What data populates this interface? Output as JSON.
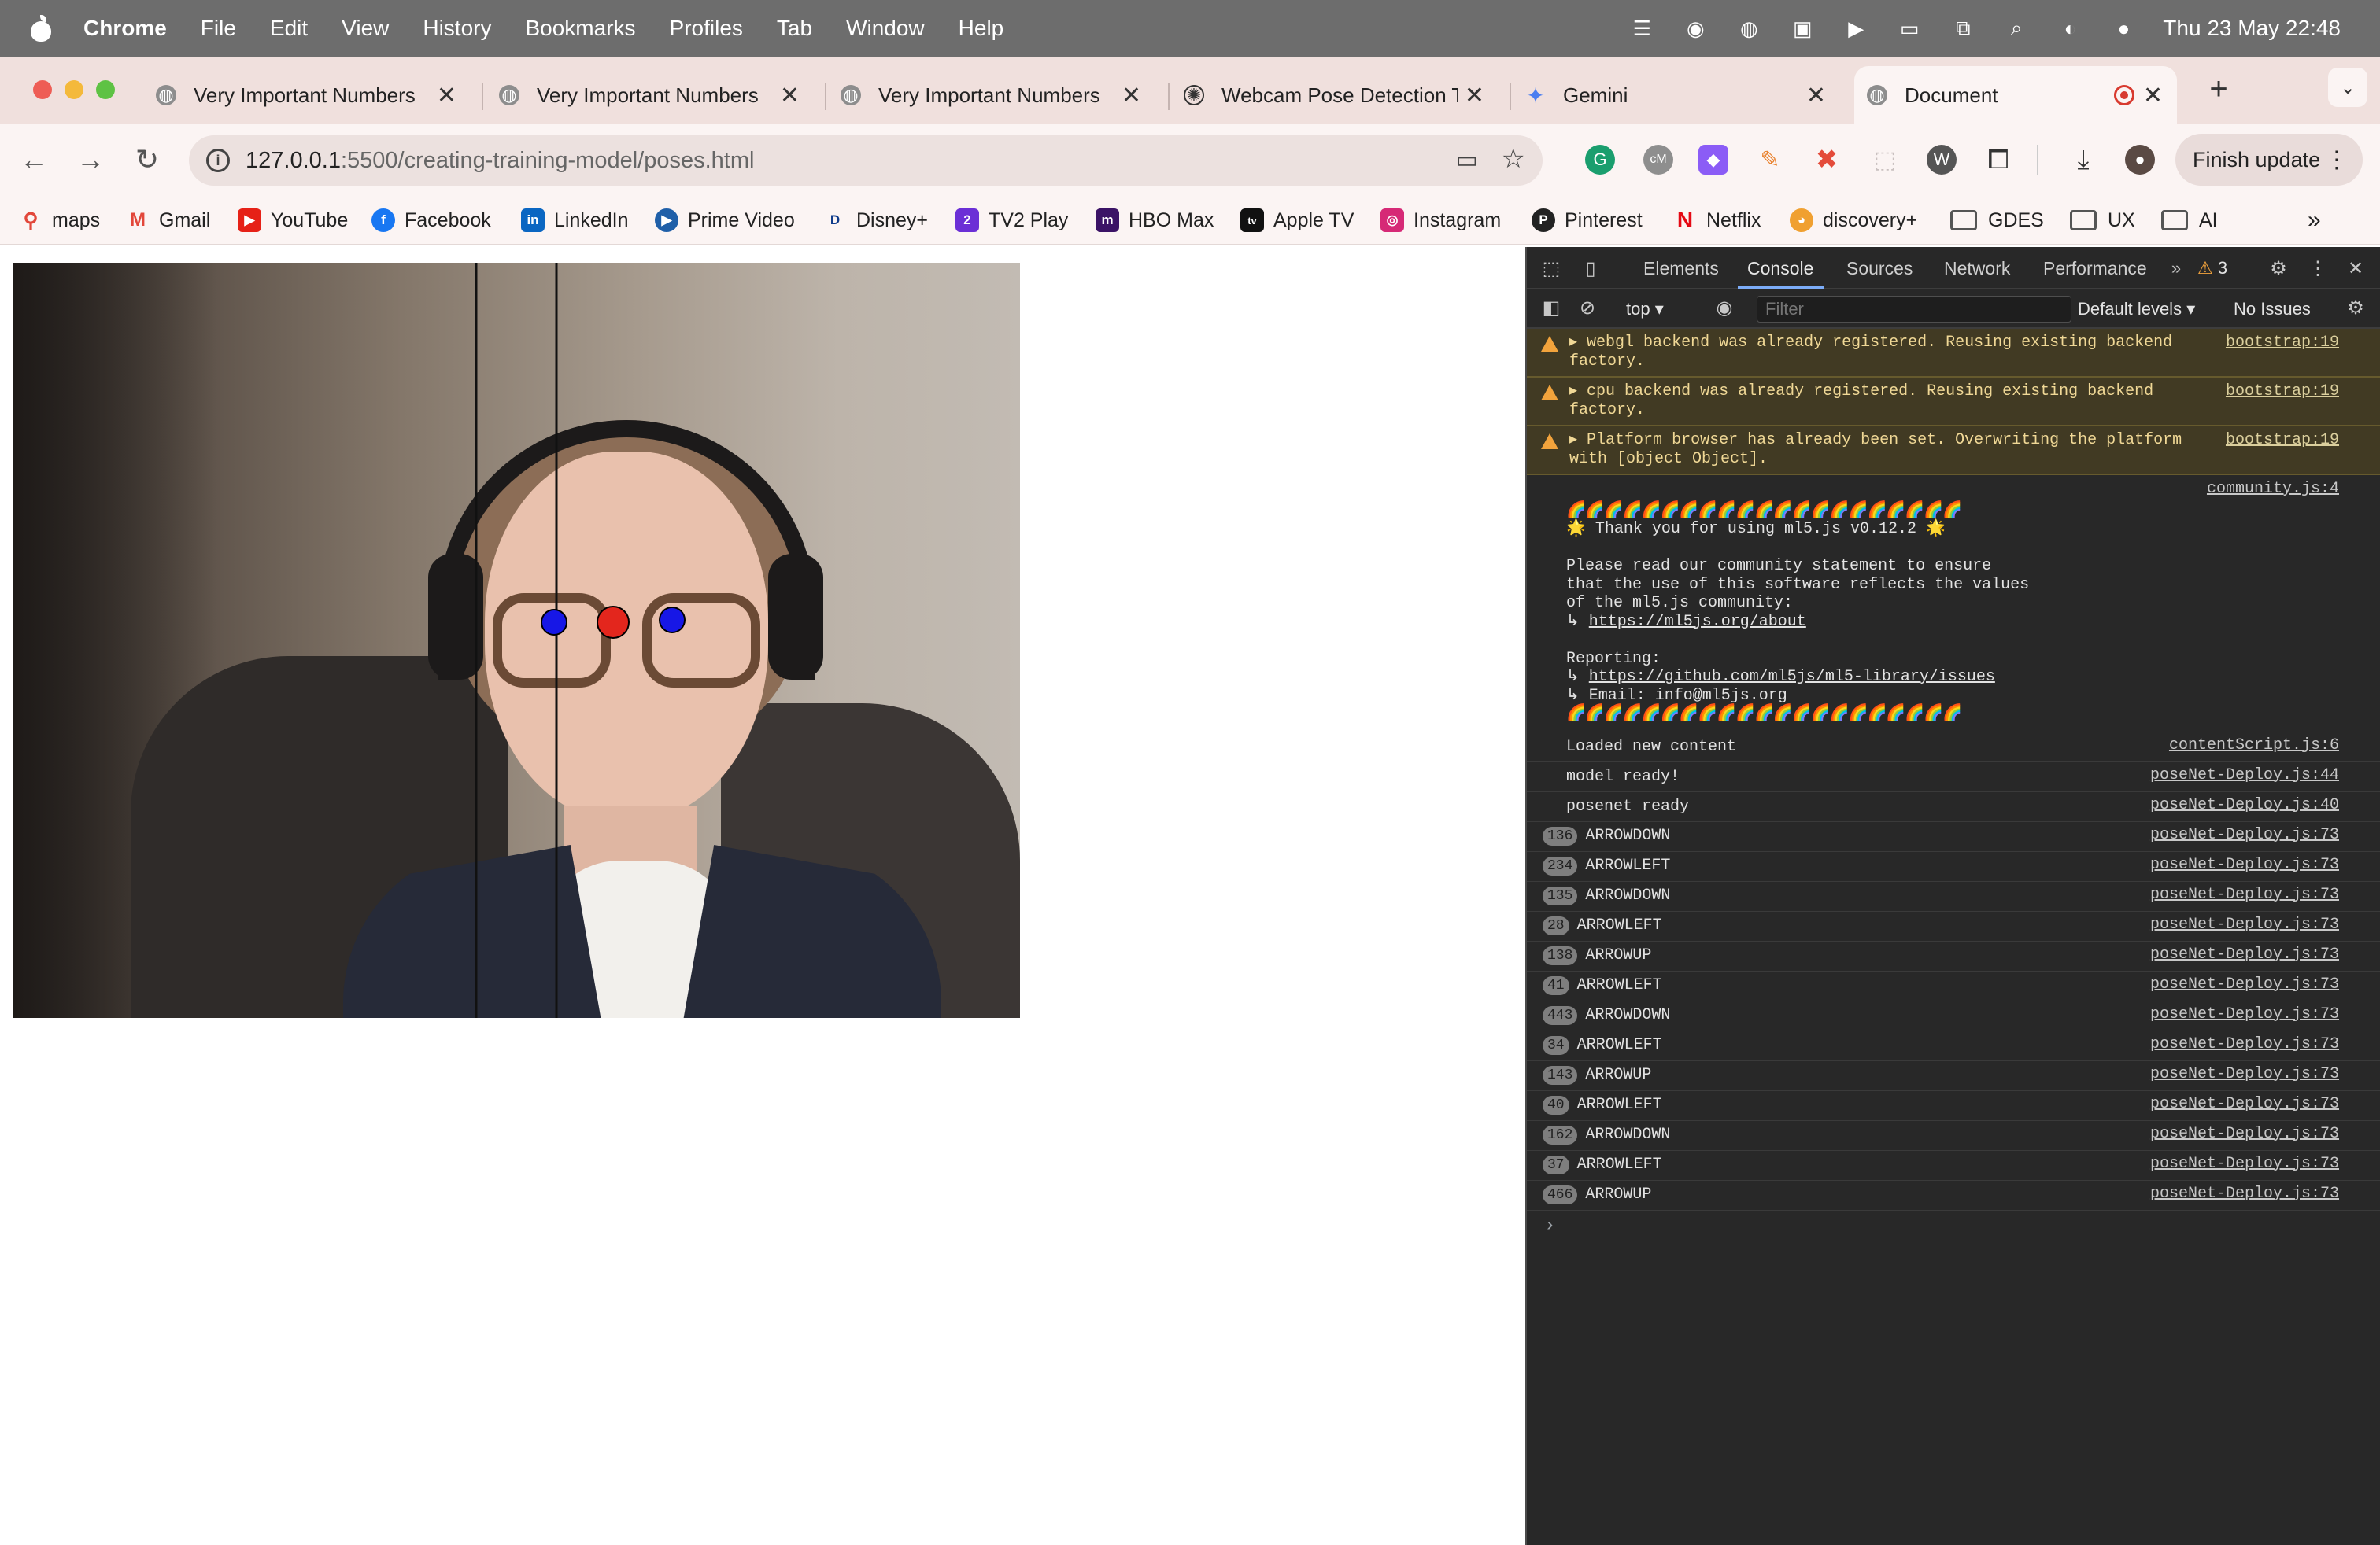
{
  "menubar": {
    "app": "Chrome",
    "items": [
      "File",
      "Edit",
      "View",
      "History",
      "Bookmarks",
      "Profiles",
      "Tab",
      "Window",
      "Help"
    ],
    "clock": "Thu 23 May  22:48"
  },
  "tabs": [
    {
      "title": "Very Important Numbers"
    },
    {
      "title": "Very Important Numbers"
    },
    {
      "title": "Very Important Numbers"
    },
    {
      "title": "Webcam Pose Detection T"
    },
    {
      "title": "Gemini"
    },
    {
      "title": "Document"
    }
  ],
  "toolbar": {
    "url_host": "127.0.0.1",
    "url_path": ":5500/creating-training-model/poses.html",
    "finish_update": "Finish update"
  },
  "bookmarks": [
    {
      "label": "maps"
    },
    {
      "label": "Gmail"
    },
    {
      "label": "YouTube"
    },
    {
      "label": "Facebook"
    },
    {
      "label": "LinkedIn"
    },
    {
      "label": "Prime Video"
    },
    {
      "label": "Disney+"
    },
    {
      "label": "TV2 Play"
    },
    {
      "label": "HBO Max"
    },
    {
      "label": "Apple TV"
    },
    {
      "label": "Instagram"
    },
    {
      "label": "Pinterest"
    },
    {
      "label": "Netflix"
    },
    {
      "label": "discovery+"
    },
    {
      "label": "GDES"
    },
    {
      "label": "UX"
    },
    {
      "label": "AI"
    }
  ],
  "devtools": {
    "tabs": [
      "Elements",
      "Console",
      "Sources",
      "Network",
      "Performance"
    ],
    "warning_count": "3",
    "context": "top",
    "filter_placeholder": "Filter",
    "levels": "Default levels",
    "issues": "No Issues",
    "warnings": [
      {
        "text": "webgl backend was already registered. Reusing existing backend factory.",
        "src": "bootstrap:19"
      },
      {
        "text": "cpu backend was already registered. Reusing existing backend factory.",
        "src": "bootstrap:19"
      },
      {
        "text": "Platform browser has already been set. Overwriting the platform with [object Object].",
        "src": "bootstrap:19"
      }
    ],
    "banner": {
      "src": "community.js:4",
      "rainbow": "🌈🌈🌈🌈🌈🌈🌈🌈🌈🌈🌈🌈🌈🌈🌈🌈🌈🌈🌈🌈🌈",
      "thanks": "🌟 Thank you for using ml5.js v0.12.2 🌟",
      "line1": "Please read our community statement to ensure",
      "line2": "that the use of this software reflects the values",
      "line3": "of the ml5.js community:",
      "about_link": "https://ml5js.org/about",
      "reporting": "Reporting:",
      "issues_link": "https://github.com/ml5js/ml5-library/issues",
      "email": "↳ Email: info@ml5js.org"
    },
    "logs": [
      {
        "text": "Loaded new content",
        "src": "contentScript.js:6"
      },
      {
        "text": "model ready!",
        "src": "poseNet-Deploy.js:44"
      },
      {
        "text": "posenet ready",
        "src": "poseNet-Deploy.js:40"
      }
    ],
    "counted_logs": [
      {
        "count": "136",
        "text": "ARROWDOWN",
        "src": "poseNet-Deploy.js:73"
      },
      {
        "count": "234",
        "text": "ARROWLEFT",
        "src": "poseNet-Deploy.js:73"
      },
      {
        "count": "135",
        "text": "ARROWDOWN",
        "src": "poseNet-Deploy.js:73"
      },
      {
        "count": "28",
        "text": "ARROWLEFT",
        "src": "poseNet-Deploy.js:73"
      },
      {
        "count": "138",
        "text": "ARROWUP",
        "src": "poseNet-Deploy.js:73"
      },
      {
        "count": "41",
        "text": "ARROWLEFT",
        "src": "poseNet-Deploy.js:73"
      },
      {
        "count": "443",
        "text": "ARROWDOWN",
        "src": "poseNet-Deploy.js:73"
      },
      {
        "count": "34",
        "text": "ARROWLEFT",
        "src": "poseNet-Deploy.js:73"
      },
      {
        "count": "143",
        "text": "ARROWUP",
        "src": "poseNet-Deploy.js:73"
      },
      {
        "count": "40",
        "text": "ARROWLEFT",
        "src": "poseNet-Deploy.js:73"
      },
      {
        "count": "162",
        "text": "ARROWDOWN",
        "src": "poseNet-Deploy.js:73"
      },
      {
        "count": "37",
        "text": "ARROWLEFT",
        "src": "poseNet-Deploy.js:73"
      },
      {
        "count": "466",
        "text": "ARROWUP",
        "src": "poseNet-Deploy.js:73"
      }
    ]
  },
  "colors": {
    "pose_nose": "#e3261d",
    "pose_eyes": "#1717e6",
    "tabstrip_bg": "#f0e0dd"
  }
}
